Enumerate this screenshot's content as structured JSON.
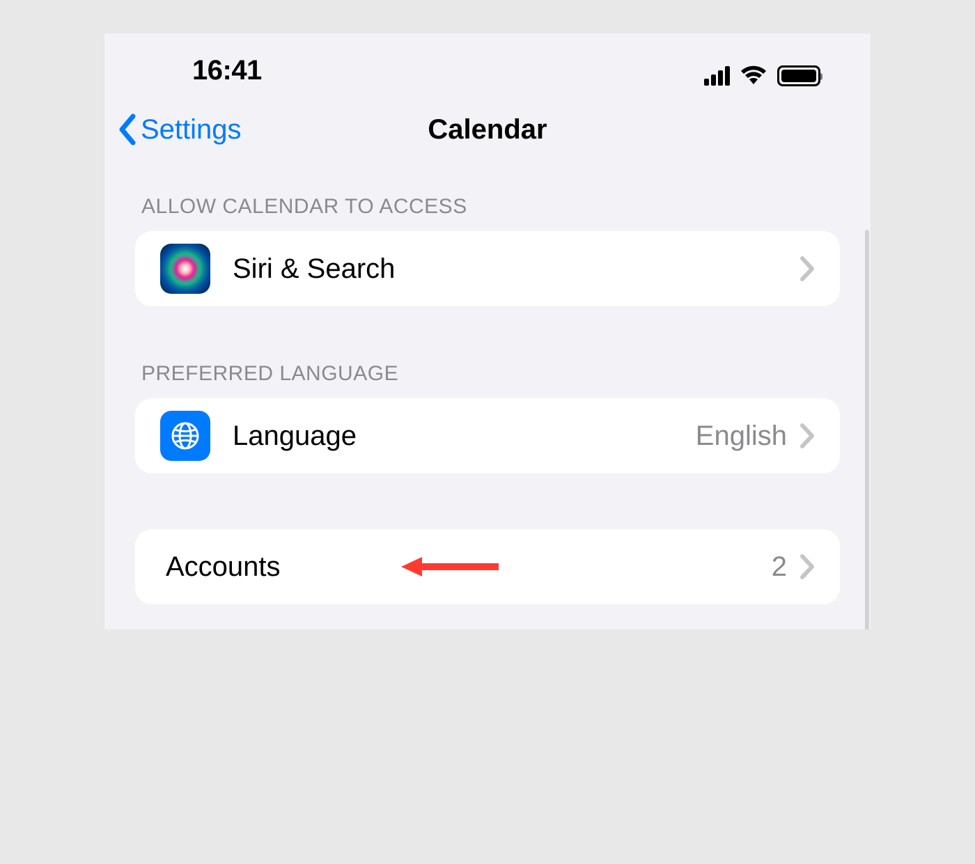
{
  "statusBar": {
    "time": "16:41"
  },
  "navBar": {
    "backLabel": "Settings",
    "title": "Calendar"
  },
  "sections": {
    "access": {
      "header": "ALLOW CALENDAR TO ACCESS",
      "siriLabel": "Siri & Search"
    },
    "language": {
      "header": "PREFERRED LANGUAGE",
      "label": "Language",
      "value": "English"
    },
    "accounts": {
      "label": "Accounts",
      "value": "2"
    }
  }
}
